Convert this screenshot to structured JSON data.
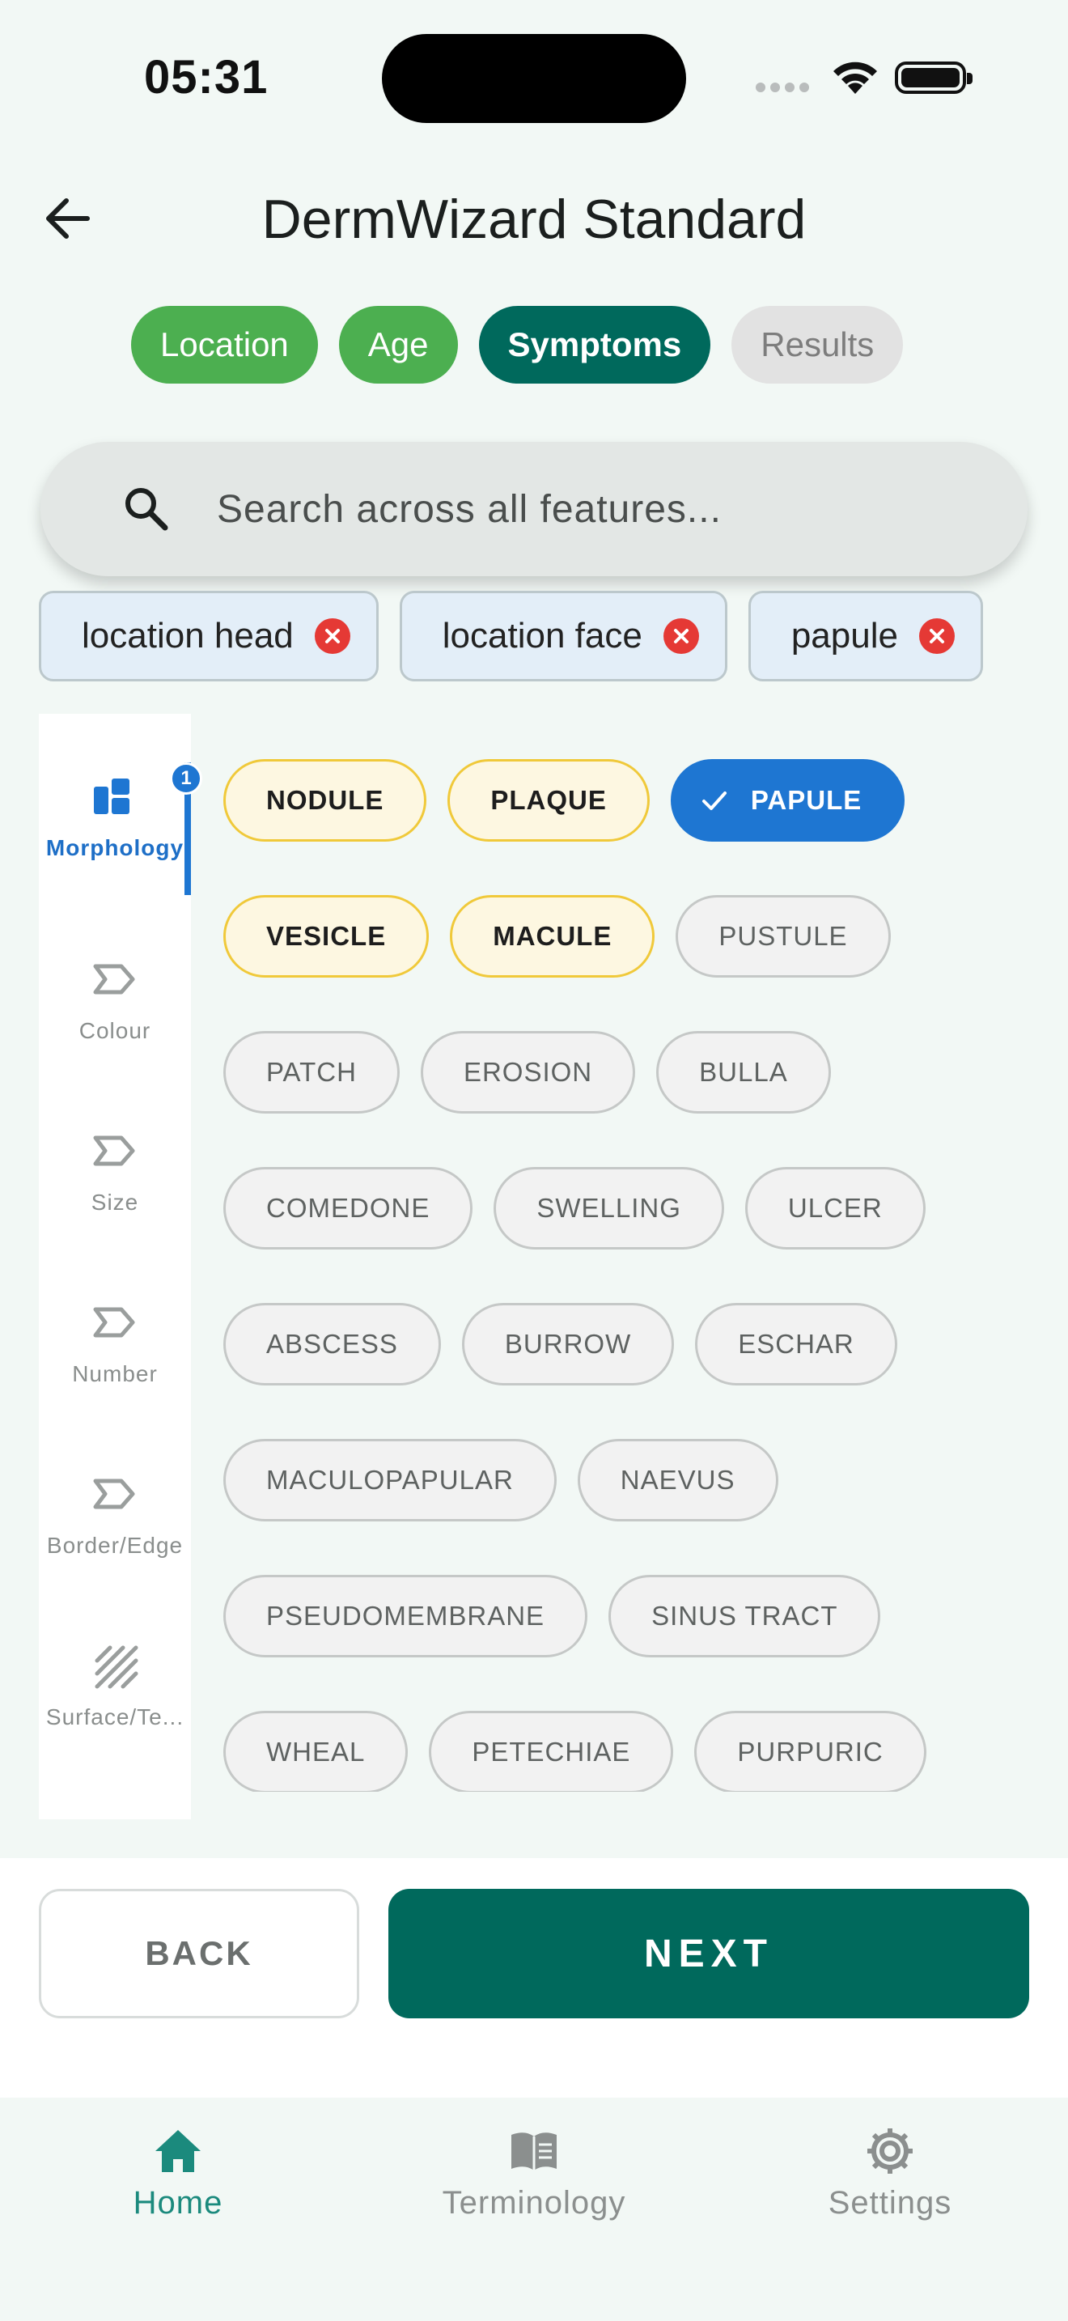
{
  "status": {
    "time": "05:31"
  },
  "header": {
    "title": "DermWizard Standard"
  },
  "steps": [
    {
      "label": "Location",
      "state": "done"
    },
    {
      "label": "Age",
      "state": "done"
    },
    {
      "label": "Symptoms",
      "state": "active"
    },
    {
      "label": "Results",
      "state": "pending"
    }
  ],
  "search": {
    "placeholder": "Search across all features..."
  },
  "active_filters": [
    "location head",
    "location face",
    "papule"
  ],
  "rail": [
    {
      "label": "Morphology",
      "icon": "morphology-icon",
      "active": true,
      "badge": "1"
    },
    {
      "label": "Colour",
      "icon": "chevron-tag-icon"
    },
    {
      "label": "Size",
      "icon": "chevron-tag-icon"
    },
    {
      "label": "Number",
      "icon": "chevron-tag-icon"
    },
    {
      "label": "Border/Edge",
      "icon": "chevron-tag-icon"
    },
    {
      "label": "Surface/Te...",
      "icon": "hatch-icon"
    }
  ],
  "chips": {
    "row1": [
      "NODULE",
      "PLAQUE",
      "PAPULE"
    ],
    "row2": [
      "VESICLE",
      "MACULE",
      "PUSTULE"
    ],
    "row3": [
      "PATCH",
      "EROSION",
      "BULLA"
    ],
    "row4": [
      "COMEDONE",
      "SWELLING",
      "ULCER"
    ],
    "row5": [
      "ABSCESS",
      "BURROW",
      "ESCHAR"
    ],
    "row6": [
      "MACULOPAPULAR",
      "NAEVUS"
    ],
    "row7": [
      "PSEUDOMEMBRANE",
      "SINUS TRACT"
    ],
    "row8": [
      "WHEAL",
      "PETECHIAE",
      "PURPURIC"
    ],
    "selected": "PAPULE",
    "highlighted": [
      "NODULE",
      "PLAQUE",
      "VESICLE",
      "MACULE"
    ]
  },
  "actions": {
    "back": "BACK",
    "next": "NEXT"
  },
  "nav": [
    {
      "label": "Home",
      "icon": "home-icon",
      "active": true
    },
    {
      "label": "Terminology",
      "icon": "book-icon"
    },
    {
      "label": "Settings",
      "icon": "gear-icon"
    }
  ],
  "colors": {
    "primary": "#00695c",
    "done": "#4caf50",
    "selected": "#1e76d2",
    "highlight": "#f0c93a",
    "remove": "#e53935"
  }
}
